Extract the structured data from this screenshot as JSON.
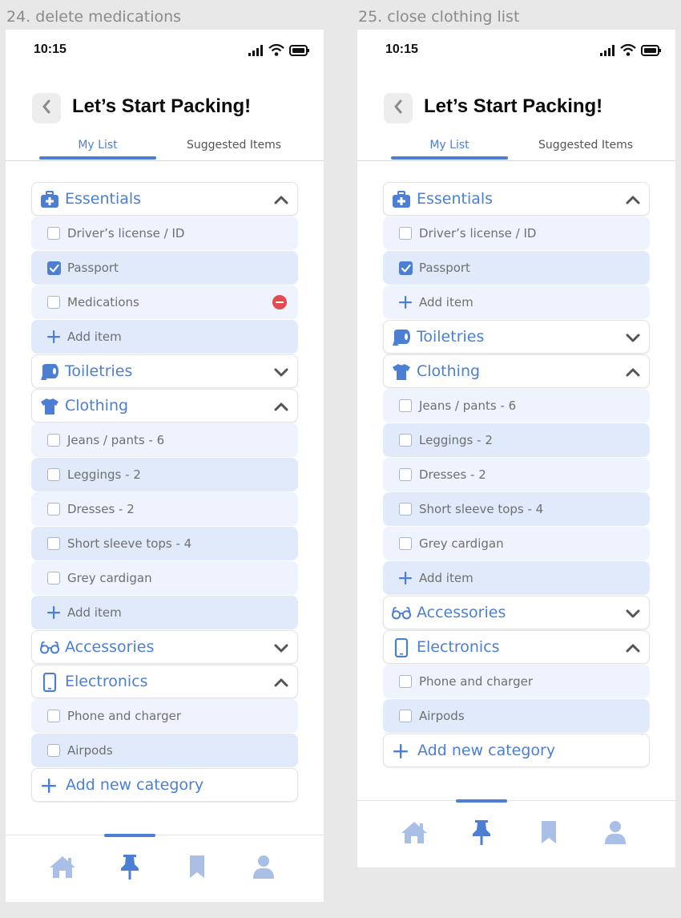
{
  "colors": {
    "accent": "#4c7fd3",
    "icon_light": "#a9bfe6",
    "remove": "#e24c4c",
    "row_light": "#eef3fd",
    "row_dark": "#e1eafb"
  },
  "screens": [
    {
      "frame_title": "24. delete medications",
      "status_time": "10:15",
      "title": "Let’s Start Packing!",
      "tabs": [
        "My List",
        "Suggested Items"
      ],
      "rows": [
        {
          "kind": "category",
          "icon": "first-aid-kit-icon",
          "label": "Essentials",
          "expanded": true
        },
        {
          "kind": "item",
          "label": "Driver’s license / ID",
          "checked": false
        },
        {
          "kind": "item",
          "label": "Passport",
          "checked": true
        },
        {
          "kind": "item",
          "label": "Medications",
          "checked": false,
          "removable": true
        },
        {
          "kind": "add",
          "label": "Add item"
        },
        {
          "kind": "category",
          "icon": "toilet-paper-icon",
          "label": "Toiletries",
          "expanded": false
        },
        {
          "kind": "category",
          "icon": "tshirt-icon",
          "label": "Clothing",
          "expanded": true
        },
        {
          "kind": "item",
          "label": "Jeans / pants - 6",
          "checked": false
        },
        {
          "kind": "item",
          "label": "Leggings - 2",
          "checked": false
        },
        {
          "kind": "item",
          "label": "Dresses - 2",
          "checked": false
        },
        {
          "kind": "item",
          "label": "Short sleeve tops - 4",
          "checked": false
        },
        {
          "kind": "item",
          "label": "Grey cardigan",
          "checked": false
        },
        {
          "kind": "add",
          "label": "Add item"
        },
        {
          "kind": "category",
          "icon": "glasses-icon",
          "label": "Accessories",
          "expanded": false
        },
        {
          "kind": "category",
          "icon": "phone-icon",
          "label": "Electronics",
          "expanded": true
        },
        {
          "kind": "item",
          "label": "Phone and charger",
          "checked": false
        },
        {
          "kind": "item",
          "label": "Airpods",
          "checked": false
        },
        {
          "kind": "addcat",
          "label": "Add new category"
        }
      ],
      "nav": [
        "home-icon",
        "pin-icon",
        "bookmark-icon",
        "profile-icon"
      ],
      "nav_active": 1
    },
    {
      "frame_title": "25. close clothing list",
      "status_time": "10:15",
      "title": "Let’s Start Packing!",
      "tabs": [
        "My List",
        "Suggested Items"
      ],
      "rows": [
        {
          "kind": "category",
          "icon": "first-aid-kit-icon",
          "label": "Essentials",
          "expanded": true
        },
        {
          "kind": "item",
          "label": "Driver’s license / ID",
          "checked": false
        },
        {
          "kind": "item",
          "label": "Passport",
          "checked": true
        },
        {
          "kind": "add",
          "label": "Add item"
        },
        {
          "kind": "category",
          "icon": "toilet-paper-icon",
          "label": "Toiletries",
          "expanded": false
        },
        {
          "kind": "category",
          "icon": "tshirt-icon",
          "label": "Clothing",
          "expanded": true
        },
        {
          "kind": "item",
          "label": "Jeans / pants - 6",
          "checked": false
        },
        {
          "kind": "item",
          "label": "Leggings - 2",
          "checked": false
        },
        {
          "kind": "item",
          "label": "Dresses - 2",
          "checked": false
        },
        {
          "kind": "item",
          "label": "Short sleeve tops - 4",
          "checked": false
        },
        {
          "kind": "item",
          "label": "Grey cardigan",
          "checked": false
        },
        {
          "kind": "add",
          "label": "Add item"
        },
        {
          "kind": "category",
          "icon": "glasses-icon",
          "label": "Accessories",
          "expanded": false
        },
        {
          "kind": "category",
          "icon": "phone-icon",
          "label": "Electronics",
          "expanded": true
        },
        {
          "kind": "item",
          "label": "Phone and charger",
          "checked": false
        },
        {
          "kind": "item",
          "label": "Airpods",
          "checked": false
        },
        {
          "kind": "addcat",
          "label": "Add new category"
        }
      ],
      "nav": [
        "home-icon",
        "pin-icon",
        "bookmark-icon",
        "profile-icon"
      ],
      "nav_active": 1
    }
  ]
}
